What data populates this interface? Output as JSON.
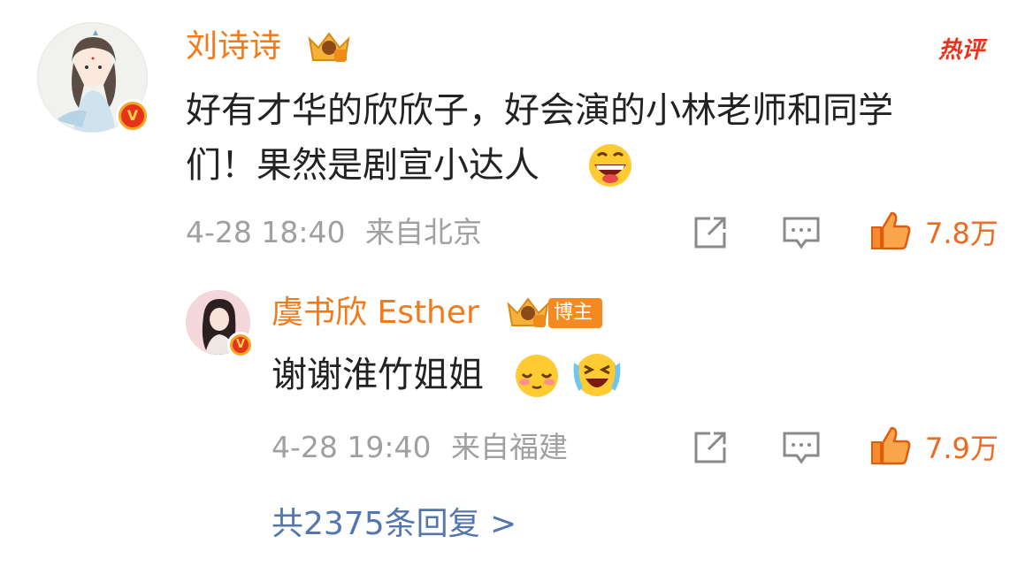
{
  "comment": {
    "author": "刘诗诗",
    "hot_badge": "热评",
    "text_line1": "好有才华的欣欣子，好会演的小林老师和同学",
    "text_line2": "们！果然是剧宣小达人",
    "time": "4-28 18:40",
    "location": "来自北京",
    "likes": "7.8万"
  },
  "reply": {
    "author": "虞书欣 Esther",
    "author_badge": "博主",
    "text": "谢谢淮竹姐姐",
    "time": "4-28 19:40",
    "location": "来自福建",
    "likes": "7.9万"
  },
  "more_replies": "共2375条回复 >",
  "icons": [
    "vip-crown-icon",
    "verified-v-icon",
    "share-icon",
    "comment-icon",
    "like-icon",
    "grin-emoji",
    "shy-emoji",
    "laugh-cry-emoji"
  ],
  "colors": {
    "name": "#f27a1a",
    "like": "#f06a1e",
    "link": "#5376b0",
    "hot": "#e8331c"
  }
}
